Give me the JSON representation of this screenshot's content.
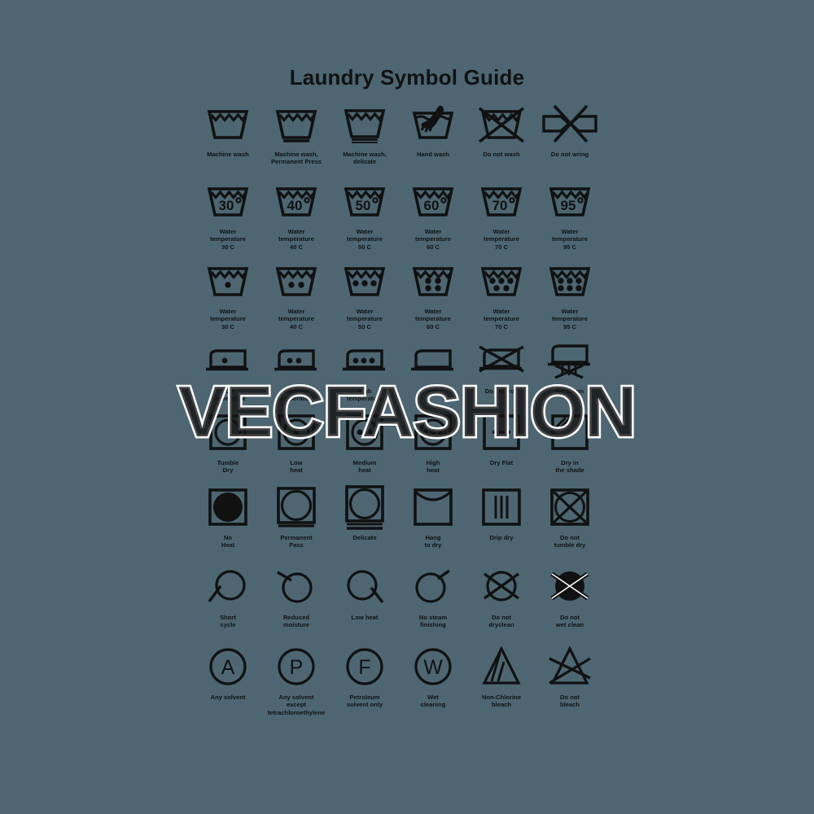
{
  "page": {
    "title": "Laundry Symbol Guide",
    "background_color": "#4d6672",
    "ink_color": "#111111",
    "watermark": "VECFASHION"
  },
  "rows": [
    {
      "name": "washing-methods",
      "cells": [
        {
          "icon": "machine-wash-tub-icon",
          "label": "Machine wash"
        },
        {
          "icon": "machine-wash-permanent-press-tub-icon",
          "label": "Machine wash,\nPermanent Press"
        },
        {
          "icon": "machine-wash-delicate-tub-icon",
          "label": "Machine wash,\ndelicate"
        },
        {
          "icon": "hand-wash-tub-icon",
          "label": "Hand wash"
        },
        {
          "icon": "do-not-wash-tub-icon",
          "label": "Do not wash"
        },
        {
          "icon": "do-not-wring-icon",
          "label": "Do not wring"
        }
      ]
    },
    {
      "name": "water-temperature-numeric",
      "cells": [
        {
          "icon": "wash-tub-30-degree-icon",
          "value": "30",
          "label": "Water\ntemperature\n30 C"
        },
        {
          "icon": "wash-tub-40-degree-icon",
          "value": "40",
          "label": "Water\ntemperature\n40 C"
        },
        {
          "icon": "wash-tub-50-degree-icon",
          "value": "50",
          "label": "Water\ntemperature\n50 C"
        },
        {
          "icon": "wash-tub-60-degree-icon",
          "value": "60",
          "label": "Water\ntemperature\n60 C"
        },
        {
          "icon": "wash-tub-70-degree-icon",
          "value": "70",
          "label": "Water\ntemperature\n70 C"
        },
        {
          "icon": "wash-tub-95-degree-icon",
          "value": "95",
          "label": "Water\ntemperature\n95 C"
        }
      ]
    },
    {
      "name": "water-temperature-dots",
      "cells": [
        {
          "icon": "wash-tub-one-dot-icon",
          "dots": 1,
          "label": "Water\ntemperature\n30 C"
        },
        {
          "icon": "wash-tub-two-dots-icon",
          "dots": 2,
          "label": "Water\ntemperature\n40 C"
        },
        {
          "icon": "wash-tub-three-dots-icon",
          "dots": 3,
          "label": "Water\ntemperature\n50 C"
        },
        {
          "icon": "wash-tub-four-dots-icon",
          "dots": 4,
          "label": "Water\ntemperature\n60 C"
        },
        {
          "icon": "wash-tub-five-dots-icon",
          "dots": 5,
          "label": "Water\ntemperature\n70 C"
        },
        {
          "icon": "wash-tub-six-dots-icon",
          "dots": 6,
          "label": "Water\ntemperature\n95 C"
        }
      ]
    },
    {
      "name": "ironing",
      "cells": [
        {
          "icon": "iron-one-dot-icon",
          "label": "Low\ntemperature"
        },
        {
          "icon": "iron-two-dots-icon",
          "label": "Medium\ntemperature"
        },
        {
          "icon": "iron-three-dots-icon",
          "label": "High\ntemperature"
        },
        {
          "icon": "iron-icon",
          "label": "Iron"
        },
        {
          "icon": "do-not-iron-icon",
          "label": "Do not iron"
        },
        {
          "icon": "no-steam-iron-icon",
          "label": "No steam"
        }
      ]
    },
    {
      "name": "tumble-drying",
      "cells": [
        {
          "icon": "tumble-dry-icon",
          "label": "Tumble\nDry"
        },
        {
          "icon": "tumble-dry-low-heat-icon",
          "label": "Low\nheat"
        },
        {
          "icon": "tumble-dry-medium-heat-icon",
          "label": "Medium\nheat"
        },
        {
          "icon": "tumble-dry-high-heat-icon",
          "label": "High\nheat"
        },
        {
          "icon": "dry-flat-icon",
          "label": "Dry Flat"
        },
        {
          "icon": "dry-in-shade-icon",
          "label": "Dry in\nthe shade"
        }
      ]
    },
    {
      "name": "drying-cycles",
      "cells": [
        {
          "icon": "no-heat-icon",
          "label": "No\nHeat"
        },
        {
          "icon": "permanent-press-dry-icon",
          "label": "Permanent\nPass"
        },
        {
          "icon": "delicate-dry-icon",
          "label": "Delicate"
        },
        {
          "icon": "hang-to-dry-icon",
          "label": "Hang\nto dry"
        },
        {
          "icon": "drip-dry-icon",
          "label": "Drip dry"
        },
        {
          "icon": "do-not-tumble-dry-icon",
          "label": "Do not\ntumble dry"
        }
      ]
    },
    {
      "name": "professional-care-cycles",
      "cells": [
        {
          "icon": "short-cycle-icon",
          "label": "Short\ncycle"
        },
        {
          "icon": "reduced-moisture-icon",
          "label": "Reduced\nmoisture"
        },
        {
          "icon": "low-heat-clean-icon",
          "label": "Low heat"
        },
        {
          "icon": "no-steam-finishing-icon",
          "label": "No steam\nfinishing"
        },
        {
          "icon": "do-not-dryclean-icon",
          "label": "Do not\ndryclean"
        },
        {
          "icon": "do-not-wet-clean-icon",
          "label": "Do not\nwet clean"
        }
      ]
    },
    {
      "name": "solvents-and-bleach",
      "cells": [
        {
          "icon": "circle-a-icon",
          "letter": "A",
          "label": "Any solvent"
        },
        {
          "icon": "circle-p-icon",
          "letter": "P",
          "label": "Any solvent\nexcept\ntetrachloroethylene"
        },
        {
          "icon": "circle-f-icon",
          "letter": "F",
          "label": "Petroleum\nsolvent only"
        },
        {
          "icon": "circle-w-icon",
          "letter": "W",
          "label": "Wet\ncleaning"
        },
        {
          "icon": "non-chlorine-bleach-icon",
          "label": "Non-Chlorine\nbleach"
        },
        {
          "icon": "do-not-bleach-icon",
          "label": "Do not\nbleach"
        }
      ]
    }
  ]
}
